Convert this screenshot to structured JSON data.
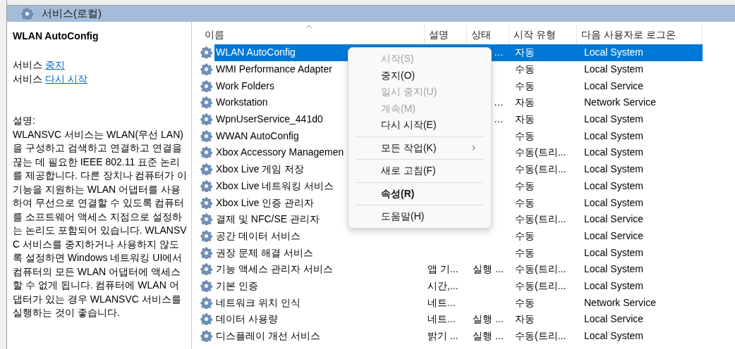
{
  "header": {
    "title": "서비스(로컬)"
  },
  "detail": {
    "name": "WLAN AutoConfig",
    "actions": [
      {
        "prefix": "서비스",
        "link": "중지"
      },
      {
        "prefix": "서비스",
        "link": "다시 시작"
      }
    ],
    "description_label": "설명:",
    "description": "WLANSVC 서비스는 WLAN(무선 LAN)을 구성하고 검색하고 연결하고 연결을 끊는 데 필요한 IEEE 802.11 표준 논리를 제공합니다. 다른 장치나 컴퓨터가 이 기능을 지원하는 WLAN 어댑터를 사용하여 무선으로 연결할 수 있도록 컴퓨터를 소프트웨어 액세스 지점으로 설정하는 논리도 포함되어 있습니다. WLANSVC 서비스를 중지하거나 사용하지 않도록 설정하면 Windows 네트워킹 UI에서 컴퓨터의 모든 WLAN 어댑터에 액세스할 수 없게 됩니다. 컴퓨터에 WLAN 어댑터가 있는 경우 WLANSVC 서비스를 실행하는 것이 좋습니다."
  },
  "table": {
    "columns": [
      "이름",
      "설명",
      "상태",
      "시작 유형",
      "다음 사용자로 로그온"
    ],
    "rows": [
      {
        "name": "WLAN AutoConfig",
        "status": "…",
        "startup": "자동",
        "logon": "Local System",
        "selected": true
      },
      {
        "name": "WMI Performance Adapter",
        "startup": "수동",
        "logon": "Local System",
        "selected": false
      },
      {
        "name": "Work Folders",
        "startup": "수동",
        "logon": "Local Service",
        "selected": false
      },
      {
        "name": "Workstation",
        "status": "…",
        "startup": "자동",
        "logon": "Network Service",
        "selected": false
      },
      {
        "name": "WpnUserService_441d0",
        "status": "…",
        "startup": "자동",
        "logon": "Local System",
        "selected": false
      },
      {
        "name": "WWAN AutoConfig",
        "startup": "수동",
        "logon": "Local System",
        "selected": false
      },
      {
        "name": "Xbox Accessory Managemen",
        "startup": "수동(트리...",
        "logon": "Local System",
        "selected": false
      },
      {
        "name": "Xbox Live 게임 저장",
        "startup": "수동(트리...",
        "logon": "Local System",
        "selected": false
      },
      {
        "name": "Xbox Live 네트워킹 서비스",
        "startup": "수동",
        "logon": "Local System",
        "selected": false
      },
      {
        "name": "Xbox Live 인증 관리자",
        "startup": "수동",
        "logon": "Local System",
        "selected": false
      },
      {
        "name": "결제 및 NFC/SE 관리자",
        "startup": "수동(트리...",
        "logon": "Local Service",
        "selected": false
      },
      {
        "name": "공간 데이터 서비스",
        "startup": "수동",
        "logon": "Local Service",
        "selected": false
      },
      {
        "name": "권장 문제 해결 서비스",
        "startup": "수동",
        "logon": "Local System",
        "selected": false
      },
      {
        "name": "기능 액세스 관리자 서비스",
        "desc": "앱 기...",
        "status": "실행 ...",
        "startup": "수동(트리...",
        "logon": "Local System",
        "selected": false
      },
      {
        "name": "기본 인증",
        "desc": "시간,...",
        "startup": "수동(트리...",
        "logon": "Local System",
        "selected": false
      },
      {
        "name": "네트워크 위치 인식",
        "desc": "네트...",
        "startup": "수동",
        "logon": "Network Service",
        "selected": false
      },
      {
        "name": "데이터 사용량",
        "desc": "네트...",
        "status": "실행 ...",
        "startup": "자동",
        "logon": "Local Service",
        "selected": false
      },
      {
        "name": "디스플레이 개선 서비스",
        "desc": "밝기 ...",
        "status": "실행 ...",
        "startup": "수동(트리...",
        "logon": "Local System",
        "selected": false
      }
    ]
  },
  "context_menu": {
    "items": [
      {
        "kind": "item",
        "label": "시작(S)",
        "disabled": true
      },
      {
        "kind": "item",
        "label": "중지(O)",
        "disabled": false
      },
      {
        "kind": "item",
        "label": "일시 중지(U)",
        "disabled": true
      },
      {
        "kind": "item",
        "label": "계속(M)",
        "disabled": true
      },
      {
        "kind": "item",
        "label": "다시 시작(E)",
        "disabled": false
      },
      {
        "kind": "separator"
      },
      {
        "kind": "item",
        "label": "모든 작업(K)",
        "disabled": false,
        "submenu": true
      },
      {
        "kind": "separator"
      },
      {
        "kind": "item",
        "label": "새로 고침(F)",
        "disabled": false
      },
      {
        "kind": "separator"
      },
      {
        "kind": "item",
        "label": "속성(R)",
        "disabled": false,
        "bold": true
      },
      {
        "kind": "separator"
      },
      {
        "kind": "item",
        "label": "도움말(H)",
        "disabled": false
      }
    ]
  }
}
